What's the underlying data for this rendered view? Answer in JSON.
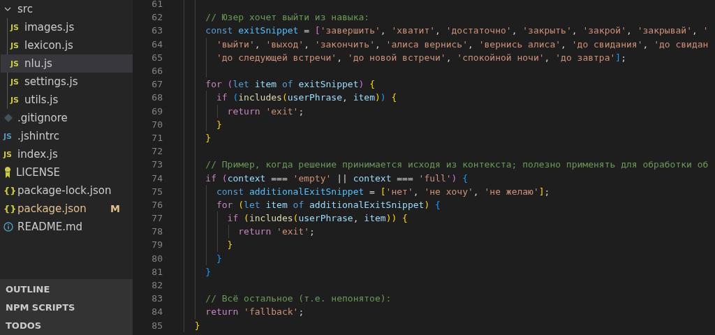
{
  "explorer": {
    "folder": {
      "name": "src",
      "expanded": true,
      "children": [
        {
          "name": "images.js",
          "kind": "js",
          "icon_text": "JS",
          "selected": false
        },
        {
          "name": "lexicon.js",
          "kind": "js",
          "icon_text": "JS",
          "selected": false
        },
        {
          "name": "nlu.js",
          "kind": "js",
          "icon_text": "JS",
          "selected": true
        },
        {
          "name": "settings.js",
          "kind": "js",
          "icon_text": "JS",
          "selected": false
        },
        {
          "name": "utils.js",
          "kind": "js",
          "icon_text": "JS",
          "selected": false
        }
      ]
    },
    "files": [
      {
        "name": ".gitignore",
        "kind": "git",
        "selected": false
      },
      {
        "name": ".jshintrc",
        "kind": "config",
        "icon_text": "JS",
        "selected": false
      },
      {
        "name": "index.js",
        "kind": "js",
        "icon_text": "JS",
        "selected": false
      },
      {
        "name": "LICENSE",
        "kind": "license",
        "selected": false
      },
      {
        "name": "package-lock.json",
        "kind": "json",
        "icon_text": "{}",
        "selected": false
      },
      {
        "name": "package.json",
        "kind": "json",
        "icon_text": "{}",
        "selected": false,
        "badge": "M"
      },
      {
        "name": "README.md",
        "kind": "info",
        "selected": false
      }
    ],
    "panels": [
      "OUTLINE",
      "NPM SCRIPTS",
      "TODOS"
    ]
  },
  "editor": {
    "lines": [
      {
        "number": "61"
      },
      {
        "number": "62",
        "tokens": [
          {
            "kind": "com",
            "text": "    // Юзер хочет выйти из навыка:"
          }
        ]
      },
      {
        "number": "63",
        "tokens": [
          {
            "kind": "kw",
            "text": "    const"
          },
          {
            "kind": "const",
            "text": " exitSnippet"
          },
          {
            "kind": "plain",
            "text": " = "
          },
          {
            "kind": "b2",
            "text": "["
          },
          {
            "kind": "str",
            "text": "'завершить'"
          },
          {
            "kind": "plain",
            "text": ", "
          },
          {
            "kind": "str",
            "text": "'хватит'"
          },
          {
            "kind": "plain",
            "text": ", "
          },
          {
            "kind": "str",
            "text": "'достаточно'"
          },
          {
            "kind": "plain",
            "text": ", "
          },
          {
            "kind": "str",
            "text": "'закрыть'"
          },
          {
            "kind": "plain",
            "text": ", "
          },
          {
            "kind": "str",
            "text": "'закрой'"
          },
          {
            "kind": "plain",
            "text": ", "
          },
          {
            "kind": "str",
            "text": "'закрывай'"
          },
          {
            "kind": "plain",
            "text": ", "
          },
          {
            "kind": "str",
            "text": "'"
          }
        ]
      },
      {
        "number": "64",
        "tokens": [
          {
            "kind": "str",
            "text": "      'выйти'"
          },
          {
            "kind": "plain",
            "text": ", "
          },
          {
            "kind": "str",
            "text": "'выход'"
          },
          {
            "kind": "plain",
            "text": ", "
          },
          {
            "kind": "str",
            "text": "'закончить'"
          },
          {
            "kind": "plain",
            "text": ", "
          },
          {
            "kind": "str",
            "text": "'алиса вернись'"
          },
          {
            "kind": "plain",
            "text": ", "
          },
          {
            "kind": "str",
            "text": "'вернись алиса'"
          },
          {
            "kind": "plain",
            "text": ", "
          },
          {
            "kind": "str",
            "text": "'до свидания'"
          },
          {
            "kind": "plain",
            "text": ", "
          },
          {
            "kind": "str",
            "text": "'до свидан"
          }
        ]
      },
      {
        "number": "65",
        "tokens": [
          {
            "kind": "str",
            "text": "      'до следующей встречи'"
          },
          {
            "kind": "plain",
            "text": ", "
          },
          {
            "kind": "str",
            "text": "'до новой встречи'"
          },
          {
            "kind": "plain",
            "text": ", "
          },
          {
            "kind": "str",
            "text": "'спокойной ночи'"
          },
          {
            "kind": "plain",
            "text": ", "
          },
          {
            "kind": "str",
            "text": "'до завтра'"
          },
          {
            "kind": "b3",
            "text": "]"
          },
          {
            "kind": "plain",
            "text": ";"
          }
        ]
      },
      {
        "number": "66"
      },
      {
        "number": "67",
        "tokens": [
          {
            "kind": "ctl",
            "text": "    for"
          },
          {
            "kind": "b2",
            "text": " ("
          },
          {
            "kind": "kw",
            "text": "let"
          },
          {
            "kind": "var",
            "text": " item"
          },
          {
            "kind": "kw",
            "text": " of"
          },
          {
            "kind": "var",
            "text": " exitSnippet"
          },
          {
            "kind": "b2",
            "text": ")"
          },
          {
            "kind": "b1",
            "text": " {"
          }
        ]
      },
      {
        "number": "68",
        "tokens": [
          {
            "kind": "ctl",
            "text": "      if"
          },
          {
            "kind": "b3",
            "text": " ("
          },
          {
            "kind": "fn",
            "text": "includes"
          },
          {
            "kind": "b1",
            "text": "("
          },
          {
            "kind": "var",
            "text": "userPhrase"
          },
          {
            "kind": "plain",
            "text": ", "
          },
          {
            "kind": "var",
            "text": "item"
          },
          {
            "kind": "b1",
            "text": ")"
          },
          {
            "kind": "b3",
            "text": ")"
          },
          {
            "kind": "b1",
            "text": " {"
          }
        ]
      },
      {
        "number": "69",
        "tokens": [
          {
            "kind": "ctl",
            "text": "        return"
          },
          {
            "kind": "str",
            "text": " 'exit'"
          },
          {
            "kind": "plain",
            "text": ";"
          }
        ]
      },
      {
        "number": "70",
        "tokens": [
          {
            "kind": "b1",
            "text": "      }"
          }
        ]
      },
      {
        "number": "71",
        "tokens": [
          {
            "kind": "b1",
            "text": "    }"
          }
        ]
      },
      {
        "number": "72"
      },
      {
        "number": "73",
        "tokens": [
          {
            "kind": "com",
            "text": "    // Пример, когда решение принимается исходя из контекста; полезно применять для обработки об"
          }
        ]
      },
      {
        "number": "74",
        "tokens": [
          {
            "kind": "ctl",
            "text": "    if"
          },
          {
            "kind": "b2",
            "text": " ("
          },
          {
            "kind": "var",
            "text": "context"
          },
          {
            "kind": "plain",
            "text": " === "
          },
          {
            "kind": "str",
            "text": "'empty'"
          },
          {
            "kind": "plain",
            "text": " || "
          },
          {
            "kind": "var",
            "text": "context"
          },
          {
            "kind": "plain",
            "text": " === "
          },
          {
            "kind": "str",
            "text": "'full'"
          },
          {
            "kind": "b2",
            "text": ")"
          },
          {
            "kind": "b3",
            "text": " {"
          }
        ]
      },
      {
        "number": "75",
        "tokens": [
          {
            "kind": "kw",
            "text": "      const"
          },
          {
            "kind": "const",
            "text": " additionalExitSnippet"
          },
          {
            "kind": "plain",
            "text": " = "
          },
          {
            "kind": "b1",
            "text": "["
          },
          {
            "kind": "str",
            "text": "'нет'"
          },
          {
            "kind": "plain",
            "text": ", "
          },
          {
            "kind": "str",
            "text": "'не хочу'"
          },
          {
            "kind": "plain",
            "text": ", "
          },
          {
            "kind": "str",
            "text": "'не желаю'"
          },
          {
            "kind": "b1",
            "text": "]"
          },
          {
            "kind": "plain",
            "text": ";"
          }
        ]
      },
      {
        "number": "76",
        "tokens": [
          {
            "kind": "ctl",
            "text": "      for"
          },
          {
            "kind": "b1",
            "text": " ("
          },
          {
            "kind": "kw",
            "text": "let"
          },
          {
            "kind": "var",
            "text": " item"
          },
          {
            "kind": "kw",
            "text": " of"
          },
          {
            "kind": "var",
            "text": " additionalExitSnippet"
          },
          {
            "kind": "b1",
            "text": ")"
          },
          {
            "kind": "b3",
            "text": " {"
          }
        ]
      },
      {
        "number": "77",
        "tokens": [
          {
            "kind": "ctl",
            "text": "        if"
          },
          {
            "kind": "b1",
            "text": " ("
          },
          {
            "kind": "fn",
            "text": "includes"
          },
          {
            "kind": "b1",
            "text": "("
          },
          {
            "kind": "var",
            "text": "userPhrase"
          },
          {
            "kind": "plain",
            "text": ", "
          },
          {
            "kind": "var",
            "text": "item"
          },
          {
            "kind": "b1",
            "text": "))"
          },
          {
            "kind": "b1",
            "text": " {"
          }
        ]
      },
      {
        "number": "78",
        "tokens": [
          {
            "kind": "ctl",
            "text": "          return"
          },
          {
            "kind": "str",
            "text": " 'exit'"
          },
          {
            "kind": "plain",
            "text": ";"
          }
        ]
      },
      {
        "number": "79",
        "tokens": [
          {
            "kind": "b1",
            "text": "        }"
          }
        ]
      },
      {
        "number": "80",
        "tokens": [
          {
            "kind": "b3",
            "text": "      }"
          }
        ]
      },
      {
        "number": "81",
        "tokens": [
          {
            "kind": "b3",
            "text": "    }"
          }
        ]
      },
      {
        "number": "82"
      },
      {
        "number": "83",
        "tokens": [
          {
            "kind": "com",
            "text": "    // Всё остальное (т.е. непонятое):"
          }
        ]
      },
      {
        "number": "84",
        "tokens": [
          {
            "kind": "ctl",
            "text": "    return"
          },
          {
            "kind": "str",
            "text": " 'fallback'"
          },
          {
            "kind": "plain",
            "text": ";"
          }
        ]
      },
      {
        "number": "85",
        "tokens": [
          {
            "kind": "b1",
            "text": "  }"
          }
        ]
      }
    ]
  }
}
